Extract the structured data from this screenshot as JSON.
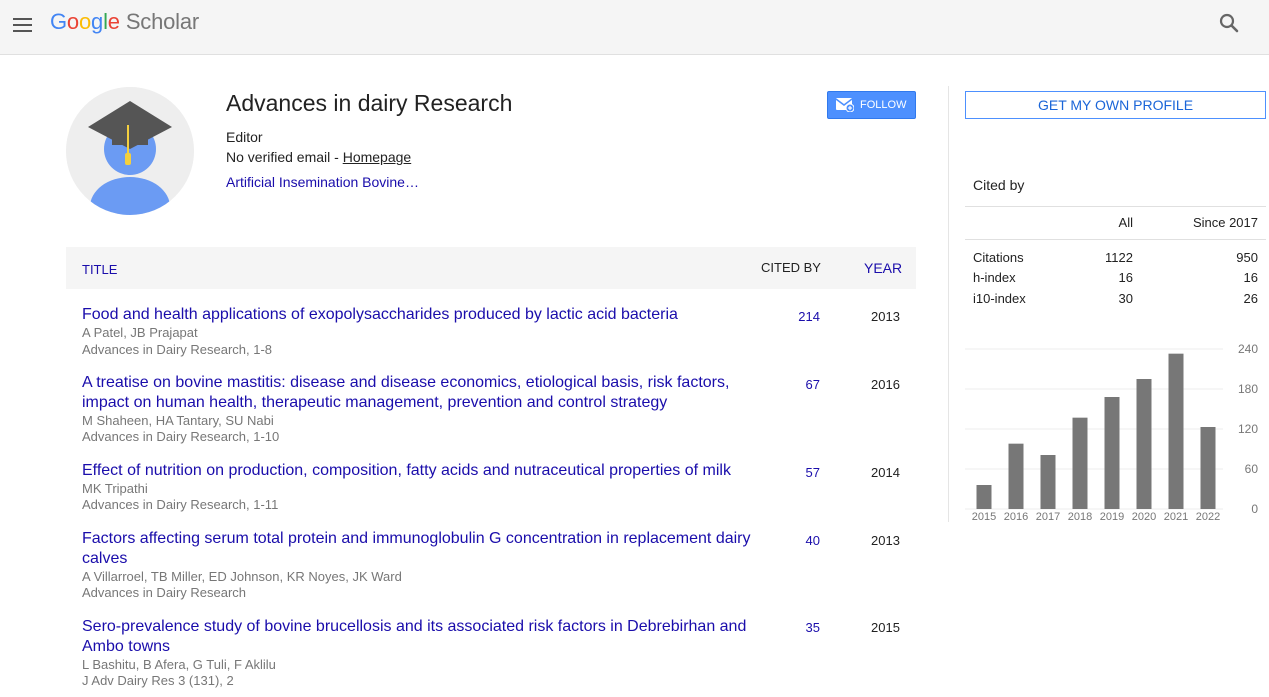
{
  "header": {
    "logo_google_letters": [
      "G",
      "o",
      "o",
      "g",
      "l",
      "e"
    ],
    "logo_product": "Scholar"
  },
  "profile": {
    "name": "Advances in dairy Research",
    "role": "Editor",
    "email_text": "No verified email - ",
    "homepage_label": "Homepage",
    "interests": "Artificial Insemination Bovine…",
    "follow_label": "FOLLOW"
  },
  "table": {
    "headers": {
      "title": "TITLE",
      "cited_by": "CITED BY",
      "year": "YEAR"
    },
    "rows": [
      {
        "title": "Food and health applications of exopolysaccharides produced by lactic acid bacteria",
        "authors": "A Patel, JB Prajapat",
        "venue": "Advances in Dairy Research, 1-8",
        "cited_by": "214",
        "year": "2013"
      },
      {
        "title": "A treatise on bovine mastitis: disease and disease economics, etiological basis, risk factors, impact on human health, therapeutic management, prevention and control strategy",
        "authors": "M Shaheen, HA Tantary, SU Nabi",
        "venue": "Advances in Dairy Research, 1-10",
        "cited_by": "67",
        "year": "2016"
      },
      {
        "title": "Effect of nutrition on production, composition, fatty acids and nutraceutical properties of milk",
        "authors": "MK Tripathi",
        "venue": "Advances in Dairy Research, 1-11",
        "cited_by": "57",
        "year": "2014"
      },
      {
        "title": "Factors affecting serum total protein and immunoglobulin G concentration in replacement dairy calves",
        "authors": "A Villarroel, TB Miller, ED Johnson, KR Noyes, JK Ward",
        "venue": "Advances in Dairy Research",
        "cited_by": "40",
        "year": "2013"
      },
      {
        "title": "Sero-prevalence study of bovine brucellosis and its associated risk factors in Debrebirhan and Ambo towns",
        "authors": "L Bashitu, B Afera, G Tuli, F Aklilu",
        "venue": "J Adv Dairy Res 3 (131), 2",
        "cited_by": "35",
        "year": "2015"
      }
    ]
  },
  "sidebar": {
    "get_profile_label": "GET MY OWN PROFILE",
    "cited_by_heading": "Cited by",
    "col_all": "All",
    "col_since": "Since 2017",
    "stats": [
      {
        "label": "Citations",
        "all": "1122",
        "since": "950"
      },
      {
        "label": "h-index",
        "all": "16",
        "since": "16"
      },
      {
        "label": "i10-index",
        "all": "30",
        "since": "26"
      }
    ]
  },
  "chart_data": {
    "type": "bar",
    "categories": [
      "2015",
      "2016",
      "2017",
      "2018",
      "2019",
      "2020",
      "2021",
      "2022"
    ],
    "values": [
      36,
      98,
      81,
      137,
      168,
      195,
      233,
      123
    ],
    "yticks": [
      "240",
      "180",
      "120",
      "60",
      "0"
    ],
    "ylim": [
      0,
      240
    ],
    "bar_color": "#777777",
    "grid": true
  },
  "colors": {
    "link": "#1a0dab",
    "follow_button": "#4d90fe",
    "topbar": "#f5f5f5"
  }
}
